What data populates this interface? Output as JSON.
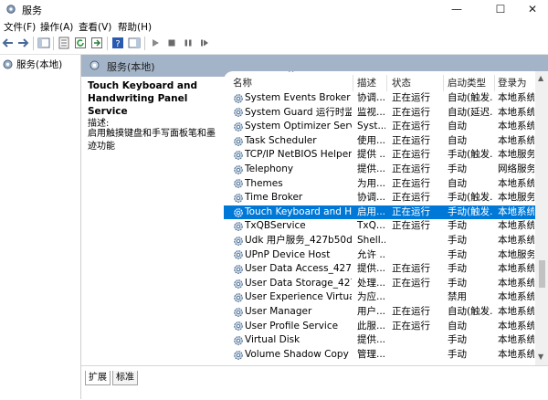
{
  "window": {
    "title": "服务",
    "minimize": "—",
    "maximize": "☐",
    "close": "✕"
  },
  "menu": [
    "文件(F)",
    "操作(A)",
    "查看(V)",
    "帮助(H)"
  ],
  "tree": {
    "root": "服务(本地)"
  },
  "pane_header": "服务(本地)",
  "description": {
    "name": "Touch Keyboard and Handwriting Panel Service",
    "label": "描述:",
    "text": "启用触摸键盘和手写面板笔和墨迹功能"
  },
  "columns": {
    "name": "名称",
    "desc": "描述",
    "status": "状态",
    "startup": "启动类型",
    "logon": "登录为",
    "sort_arrow": "^"
  },
  "rows": [
    {
      "name": "System Events Broker",
      "desc": "协调...",
      "status": "正在运行",
      "startup": "自动(触发...",
      "logon": "本地系统",
      "selected": false
    },
    {
      "name": "System Guard 运行时监视...",
      "desc": "监视...",
      "status": "正在运行",
      "startup": "自动(延迟...",
      "logon": "本地系统",
      "selected": false
    },
    {
      "name": "System Optimizer Service",
      "desc": "Syst...",
      "status": "正在运行",
      "startup": "自动",
      "logon": "本地系统",
      "selected": false
    },
    {
      "name": "Task Scheduler",
      "desc": "使用...",
      "status": "正在运行",
      "startup": "自动",
      "logon": "本地系统",
      "selected": false
    },
    {
      "name": "TCP/IP NetBIOS Helper",
      "desc": "提供 ...",
      "status": "正在运行",
      "startup": "手动(触发...",
      "logon": "本地服务",
      "selected": false
    },
    {
      "name": "Telephony",
      "desc": "提供...",
      "status": "正在运行",
      "startup": "手动",
      "logon": "网络服务",
      "selected": false
    },
    {
      "name": "Themes",
      "desc": "为用...",
      "status": "正在运行",
      "startup": "自动",
      "logon": "本地系统",
      "selected": false
    },
    {
      "name": "Time Broker",
      "desc": "协调...",
      "status": "正在运行",
      "startup": "手动(触发...",
      "logon": "本地服务",
      "selected": false
    },
    {
      "name": "Touch Keyboard and Ha...",
      "desc": "启用...",
      "status": "正在运行",
      "startup": "手动(触发...",
      "logon": "本地系统",
      "selected": true
    },
    {
      "name": "TxQBService",
      "desc": "TxQ...",
      "status": "正在运行",
      "startup": "手动",
      "logon": "本地系统",
      "selected": false
    },
    {
      "name": "Udk 用户服务_427b50d1",
      "desc": "Shell...",
      "status": "",
      "startup": "手动",
      "logon": "本地系统",
      "selected": false
    },
    {
      "name": "UPnP Device Host",
      "desc": "允许 ...",
      "status": "",
      "startup": "手动",
      "logon": "本地服务",
      "selected": false
    },
    {
      "name": "User Data Access_427b5...",
      "desc": "提供...",
      "status": "正在运行",
      "startup": "手动",
      "logon": "本地系统",
      "selected": false
    },
    {
      "name": "User Data Storage_427b...",
      "desc": "处理...",
      "status": "正在运行",
      "startup": "手动",
      "logon": "本地系统",
      "selected": false
    },
    {
      "name": "User Experience Virtualiz...",
      "desc": "为应...",
      "status": "",
      "startup": "禁用",
      "logon": "本地系统",
      "selected": false
    },
    {
      "name": "User Manager",
      "desc": "用户...",
      "status": "正在运行",
      "startup": "自动(触发...",
      "logon": "本地系统",
      "selected": false
    },
    {
      "name": "User Profile Service",
      "desc": "此服...",
      "status": "正在运行",
      "startup": "自动",
      "logon": "本地系统",
      "selected": false
    },
    {
      "name": "Virtual Disk",
      "desc": "提供...",
      "status": "",
      "startup": "手动",
      "logon": "本地系统",
      "selected": false
    },
    {
      "name": "Volume Shadow Copy",
      "desc": "管理...",
      "status": "",
      "startup": "手动",
      "logon": "本地系统",
      "selected": false
    }
  ],
  "tabs": [
    "扩展",
    "标准"
  ],
  "colors": {
    "accent": "#0078d7",
    "header_strip": "#a3b4c8"
  }
}
